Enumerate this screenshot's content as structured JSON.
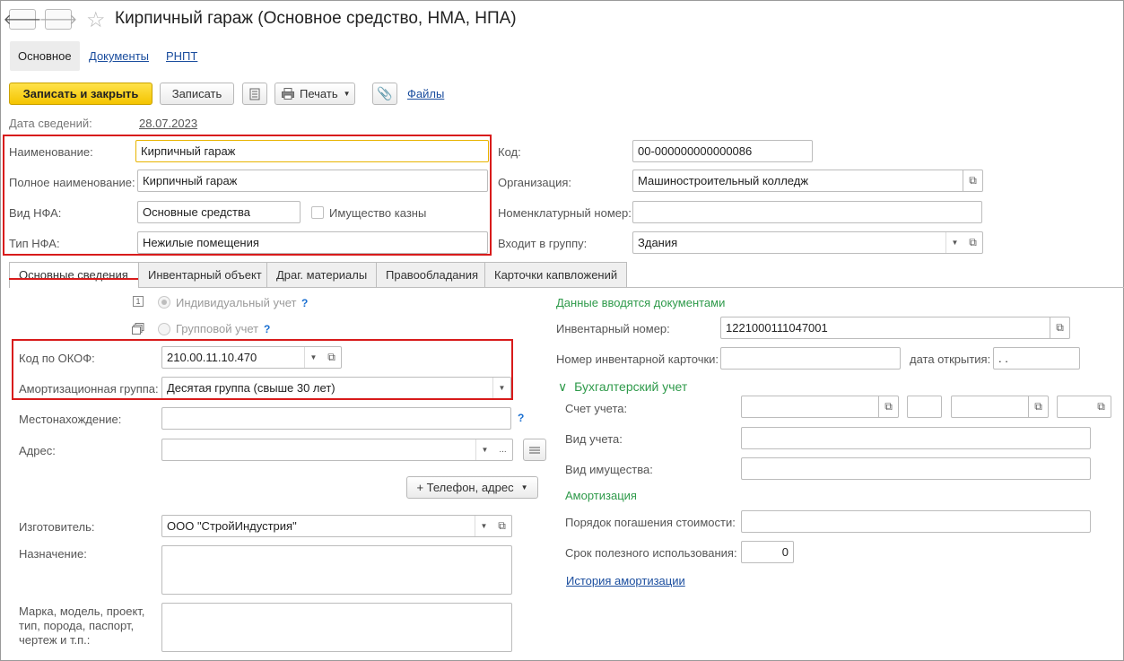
{
  "window": {
    "title": "Кирпичный гараж (Основное средство, НМА, НПА)"
  },
  "nav": {
    "back": "🡐",
    "forward": "🡒"
  },
  "section_tabs": [
    {
      "label": "Основное"
    },
    {
      "label": "Документы"
    },
    {
      "label": "РНПТ"
    }
  ],
  "toolbar": {
    "save_close": "Записать и закрыть",
    "save": "Записать",
    "print": "Печать",
    "files": "Файлы"
  },
  "header": {
    "date_label": "Дата сведений:",
    "date_value": "28.07.2023",
    "name_label": "Наименование:",
    "name_value": "Кирпичный гараж",
    "fullname_label": "Полное наименование:",
    "fullname_value": "Кирпичный гараж",
    "vid_label": "Вид НФА:",
    "vid_value": "Основные средства",
    "treasury_label": "Имущество казны",
    "tip_label": "Тип НФА:",
    "tip_value": "Нежилые помещения",
    "code_label": "Код:",
    "code_value": "00-000000000000086",
    "org_label": "Организация:",
    "org_value": "Машиностроительный колледж",
    "nomen_label": "Номенклатурный номер:",
    "nomen_value": "",
    "group_label": "Входит в группу:",
    "group_value": "Здания"
  },
  "tabs": [
    {
      "label": "Основные сведения"
    },
    {
      "label": "Инвентарный объект"
    },
    {
      "label": "Драг. материалы"
    },
    {
      "label": "Правообладания"
    },
    {
      "label": "Карточки капвложений"
    }
  ],
  "left": {
    "individual_label": "Индивидуальный учет",
    "group_label": "Групповой учет",
    "help": "?",
    "okof_label": "Код по ОКОФ:",
    "okof_value": "210.00.11.10.470",
    "amort_label": "Амортизационная группа:",
    "amort_value": "Десятая группа (свыше 30 лет)",
    "location_label": "Местонахождение:",
    "address_label": "Адрес:",
    "ellipsis": "...",
    "phone_button": "+ Телефон, адрес",
    "maker_label": "Изготовитель:",
    "maker_value": "ООО \"СтройИндустрия\"",
    "purpose_label": "Назначение:",
    "model_label_1": "Марка, модель, проект,",
    "model_label_2": "тип, порода, паспорт,",
    "model_label_3": "чертеж и т.п.:"
  },
  "right": {
    "docs_note": "Данные вводятся документами",
    "inv_label": "Инвентарный номер:",
    "inv_value": "1221000111047001",
    "card_label": "Номер инвентарной карточки:",
    "open_date_label": "дата открытия:",
    "open_date_value": " .  .",
    "accounting_header": "Бухгалтерский учет",
    "account_label": "Счет учета:",
    "account_type_label": "Вид учета:",
    "property_type_label": "Вид имущества:",
    "amort_header": "Амортизация",
    "repay_label": "Порядок погашения стоимости:",
    "life_label": "Срок полезного использования:",
    "life_value": "0",
    "history_link": "История амортизации"
  },
  "colors": {
    "highlight_red": "#d81b1b",
    "accent_yellow": "#f4c400",
    "link_blue": "#1a4d9e",
    "green_header": "#2e9a4a"
  }
}
